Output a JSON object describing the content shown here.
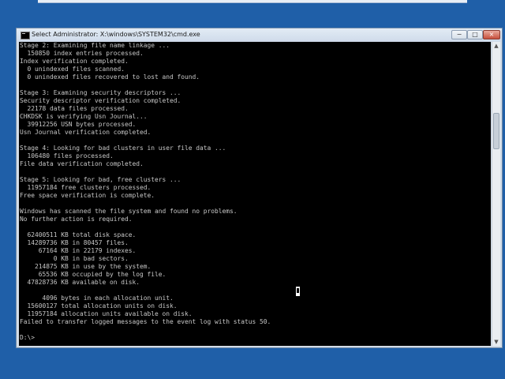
{
  "window": {
    "title": "Select Administrator: X:\\windows\\SYSTEM32\\cmd.exe",
    "controls": {
      "minimize": "−",
      "maximize": "□",
      "close": "×"
    }
  },
  "console": {
    "lines": [
      "Stage 2: Examining file name linkage ...",
      "  150850 index entries processed.",
      "Index verification completed.",
      "  0 unindexed files scanned.",
      "  0 unindexed files recovered to lost and found.",
      "",
      "Stage 3: Examining security descriptors ...",
      "Security descriptor verification completed.",
      "  22178 data files processed.",
      "CHKDSK is verifying Usn Journal...",
      "  39912256 USN bytes processed.",
      "Usn Journal verification completed.",
      "",
      "Stage 4: Looking for bad clusters in user file data ...",
      "  106480 files processed.",
      "File data verification completed.",
      "",
      "Stage 5: Looking for bad, free clusters ...",
      "  11957184 free clusters processed.",
      "Free space verification is complete.",
      "",
      "Windows has scanned the file system and found no problems.",
      "No further action is required.",
      "",
      "  62400511 KB total disk space.",
      "  14289736 KB in 80457 files.",
      "     67164 KB in 22179 indexes.",
      "         0 KB in bad sectors.",
      "    214875 KB in use by the system.",
      "     65536 KB occupied by the log file.",
      "  47828736 KB available on disk.",
      "",
      "      4096 bytes in each allocation unit.",
      "  15600127 total allocation units on disk.",
      "  11957184 allocation units available on disk.",
      "Failed to transfer logged messages to the event log with status 50.",
      "",
      "D:\\>"
    ]
  },
  "scrollbar": {
    "up_arrow": "▲",
    "down_arrow": "▼"
  },
  "icons": {
    "title_icon": "cmd-icon",
    "cursor": "mouse-pointer-icon"
  }
}
